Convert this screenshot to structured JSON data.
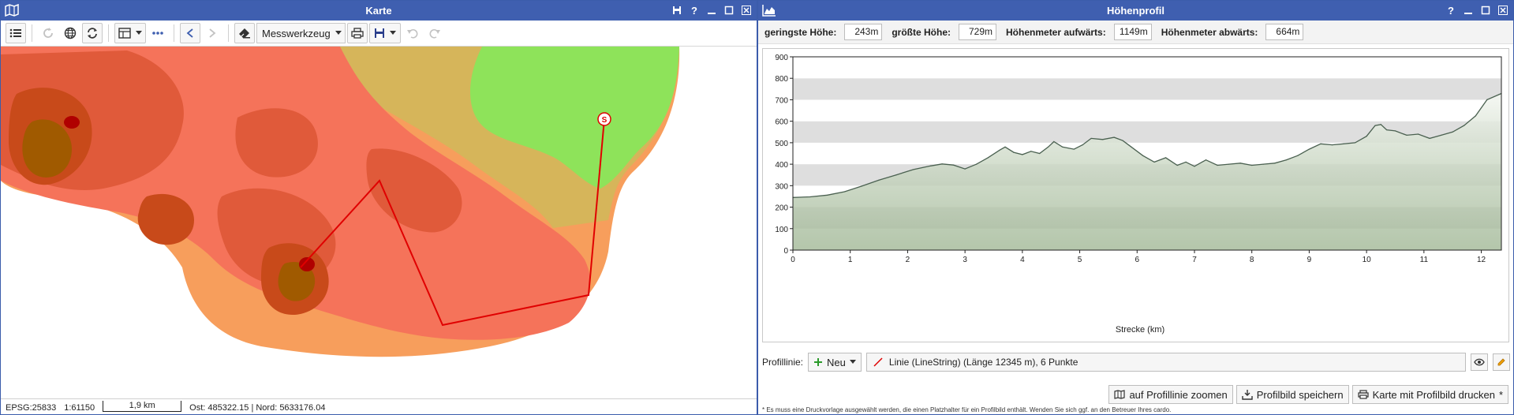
{
  "map_window": {
    "title": "Karte",
    "toolbar": {
      "measure_tool_label": "Messwerkzeug"
    },
    "map": {
      "start_marker_label": "S",
      "route_color": "#e00000",
      "elevation_colors": [
        "#a05a00",
        "#c84a1a",
        "#e8603c",
        "#f5735a",
        "#f99c5c",
        "#d6b55a",
        "#8ee35a"
      ]
    },
    "status": {
      "crs": "EPSG:25833",
      "scale": "1:61150",
      "scalebar_label": "1,9 km",
      "coordinates": "Ost: 485322.15 | Nord: 5633176.04"
    }
  },
  "profile_window": {
    "title": "Höhenprofil",
    "stats": {
      "min_label": "geringste Höhe:",
      "min_value": "243m",
      "max_label": "größte Höhe:",
      "max_value": "729m",
      "up_label": "Höhenmeter aufwärts:",
      "up_value": "1149m",
      "down_label": "Höhenmeter abwärts:",
      "down_value": "664m"
    },
    "chart_data": {
      "type": "area",
      "title": "",
      "xlabel": "Strecke (km)",
      "ylabel": "",
      "xlim": [
        0,
        12.35
      ],
      "ylim": [
        0,
        900
      ],
      "x_ticks": [
        0,
        1,
        2,
        3,
        4,
        5,
        6,
        7,
        8,
        9,
        10,
        11,
        12
      ],
      "y_ticks": [
        0,
        100,
        200,
        300,
        400,
        500,
        600,
        700,
        800,
        900
      ],
      "grid": "alternating horizontal bands",
      "series": [
        {
          "x": [
            0,
            0.3,
            0.6,
            0.9,
            1.2,
            1.5,
            1.8,
            2.1,
            2.4,
            2.6,
            2.8,
            3.0,
            3.2,
            3.4,
            3.6,
            3.7,
            3.85,
            4.0,
            4.15,
            4.3,
            4.45,
            4.55,
            4.7,
            4.9,
            5.05,
            5.2,
            5.4,
            5.6,
            5.75,
            5.9,
            6.1,
            6.3,
            6.5,
            6.7,
            6.85,
            7.0,
            7.2,
            7.4,
            7.6,
            7.8,
            8.0,
            8.2,
            8.4,
            8.6,
            8.8,
            9.0,
            9.2,
            9.4,
            9.6,
            9.8,
            10.0,
            10.15,
            10.25,
            10.35,
            10.5,
            10.7,
            10.9,
            11.1,
            11.3,
            11.5,
            11.7,
            11.9,
            12.1,
            12.35
          ],
          "y": [
            245,
            248,
            256,
            272,
            298,
            326,
            350,
            375,
            392,
            401,
            396,
            378,
            400,
            430,
            465,
            480,
            455,
            445,
            460,
            450,
            480,
            505,
            480,
            470,
            490,
            520,
            515,
            525,
            510,
            480,
            440,
            410,
            430,
            395,
            410,
            390,
            420,
            395,
            400,
            405,
            395,
            400,
            405,
            420,
            440,
            470,
            495,
            490,
            495,
            500,
            530,
            580,
            585,
            560,
            555,
            535,
            540,
            520,
            535,
            550,
            580,
            625,
            700,
            729
          ]
        }
      ]
    },
    "profile_line": {
      "label": "Profillinie:",
      "new_button": "Neu",
      "selected_line": "Linie (LineString) (Länge 12345 m), 6 Punkte"
    },
    "actions": {
      "zoom_label": "auf Profillinie zoomen",
      "save_label": "Profilbild speichern",
      "print_label": "Karte mit Profilbild drucken"
    },
    "footnote": "* Es muss eine Druckvorlage ausgewählt werden, die einen Platzhalter für ein Profilbild enthält. Wenden Sie sich ggf. an den Betreuer Ihres cardo."
  }
}
